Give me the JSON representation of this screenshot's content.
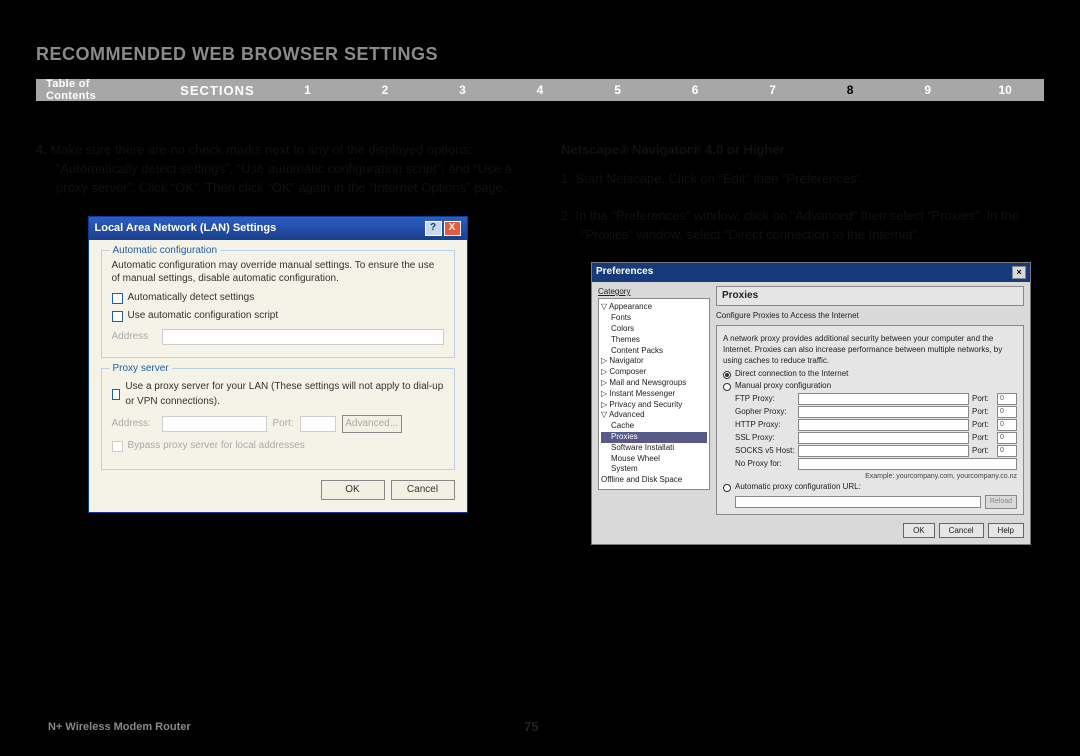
{
  "page": {
    "title": "RECOMMENDED WEB BROWSER SETTINGS",
    "toc_label": "Table of Contents",
    "sections_label": "SECTIONS",
    "section_numbers": [
      "1",
      "2",
      "3",
      "4",
      "5",
      "6",
      "7",
      "8",
      "9",
      "10"
    ],
    "active_section": "8",
    "page_number": "75",
    "product": "N+ Wireless Modem Router"
  },
  "left": {
    "step4_num": "4.",
    "step4_text": " Make sure there are no check marks next to any of the displayed options: “Automatically detect settings”, “Use automatic configuration script”, and “Use a proxy server”. Click “OK”. Then click “OK” again in the “Internet Options” page."
  },
  "lan": {
    "title": "Local Area Network (LAN) Settings",
    "auto_legend": "Automatic configuration",
    "auto_desc": "Automatic configuration may override manual settings.  To ensure the use of manual settings, disable automatic configuration.",
    "auto_detect": "Automatically detect settings",
    "auto_script": "Use automatic configuration script",
    "address_label": "Address",
    "proxy_legend": "Proxy server",
    "proxy_desc": "Use a proxy server for your LAN (These settings will not apply to dial-up or VPN connections).",
    "port_label": "Port:",
    "advanced_btn": "Advanced...",
    "bypass": "Bypass proxy server for local addresses",
    "ok": "OK",
    "cancel": "Cancel"
  },
  "right": {
    "heading": "Netscape® Navigator® 4.0 or Higher",
    "step1_num": "1.",
    "step1_text": " Start Netscape. Click on “Edit” then “Preferences”.",
    "step2_num": "2.",
    "step2_text": " In the “Preferences” window, click on “Advanced” then select “Proxies”. In the “Proxies” window, select “Direct connection to the Internet”."
  },
  "ns": {
    "title": "Preferences",
    "category_label": "Category",
    "tree": {
      "appearance": "Appearance",
      "fonts": "Fonts",
      "colors": "Colors",
      "themes": "Themes",
      "content_packs": "Content Packs",
      "navigator": "Navigator",
      "composer": "Composer",
      "mail": "Mail and Newsgroups",
      "im": "Instant Messenger",
      "privacy": "Privacy and Security",
      "advanced": "Advanced",
      "cache": "Cache",
      "proxies": "Proxies",
      "software": "Software Installati",
      "mouse": "Mouse Wheel",
      "system": "System",
      "offline": "Offline and Disk Space"
    },
    "section_title": "Proxies",
    "config_line": "Configure Proxies to Access the Internet",
    "desc": "A network proxy provides additional security between your computer and the Internet. Proxies can also increase performance between multiple networks, by using caches to reduce traffic.",
    "radio_direct": "Direct connection to the Internet",
    "radio_manual": "Manual proxy configuration",
    "ftp": "FTP Proxy:",
    "gopher": "Gopher Proxy:",
    "http": "HTTP Proxy:",
    "ssl": "SSL Proxy:",
    "socks": "SOCKS v5 Host:",
    "noproxy": "No Proxy for:",
    "port": "Port:",
    "port_zero": "0",
    "example": "Example: yourcompany.com, yourcompany.co.nz",
    "radio_auto": "Automatic proxy configuration URL:",
    "reload": "Reload",
    "ok": "OK",
    "cancel": "Cancel",
    "help": "Help"
  }
}
